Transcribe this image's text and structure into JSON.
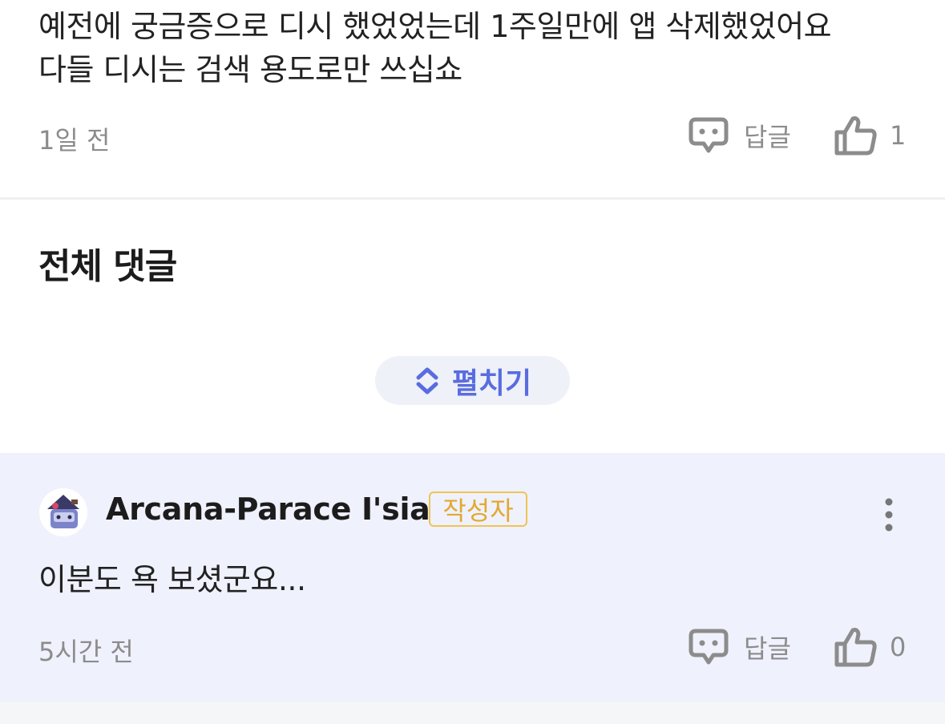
{
  "top_comment": {
    "lines": [
      "예전에 궁금증으로 디시 했었었는데 1주일만에 앱 삭제했었어요",
      "다들 디시는 검색 용도로만 쓰십쇼"
    ],
    "time": "1일 전",
    "reply_label": "답글",
    "like_count": "1"
  },
  "section": {
    "title": "전체 댓글"
  },
  "expand": {
    "label": "펼치기"
  },
  "highlight_comment": {
    "author": "Arcana-Parace I'sia",
    "badge": "작성자",
    "text": "이분도 욕 보셨군요...",
    "time": "5시간 전",
    "reply_label": "답글",
    "like_count": "0"
  },
  "colors": {
    "accent": "#5a6ce0",
    "badge": "#e2a930",
    "highlight_bg": "#eff1fc",
    "muted_text": "#8c8c8c"
  },
  "icons": [
    "speech-bubble-icon",
    "thumbs-up-icon",
    "expand-chevrons-icon",
    "more-vertical-icon"
  ]
}
